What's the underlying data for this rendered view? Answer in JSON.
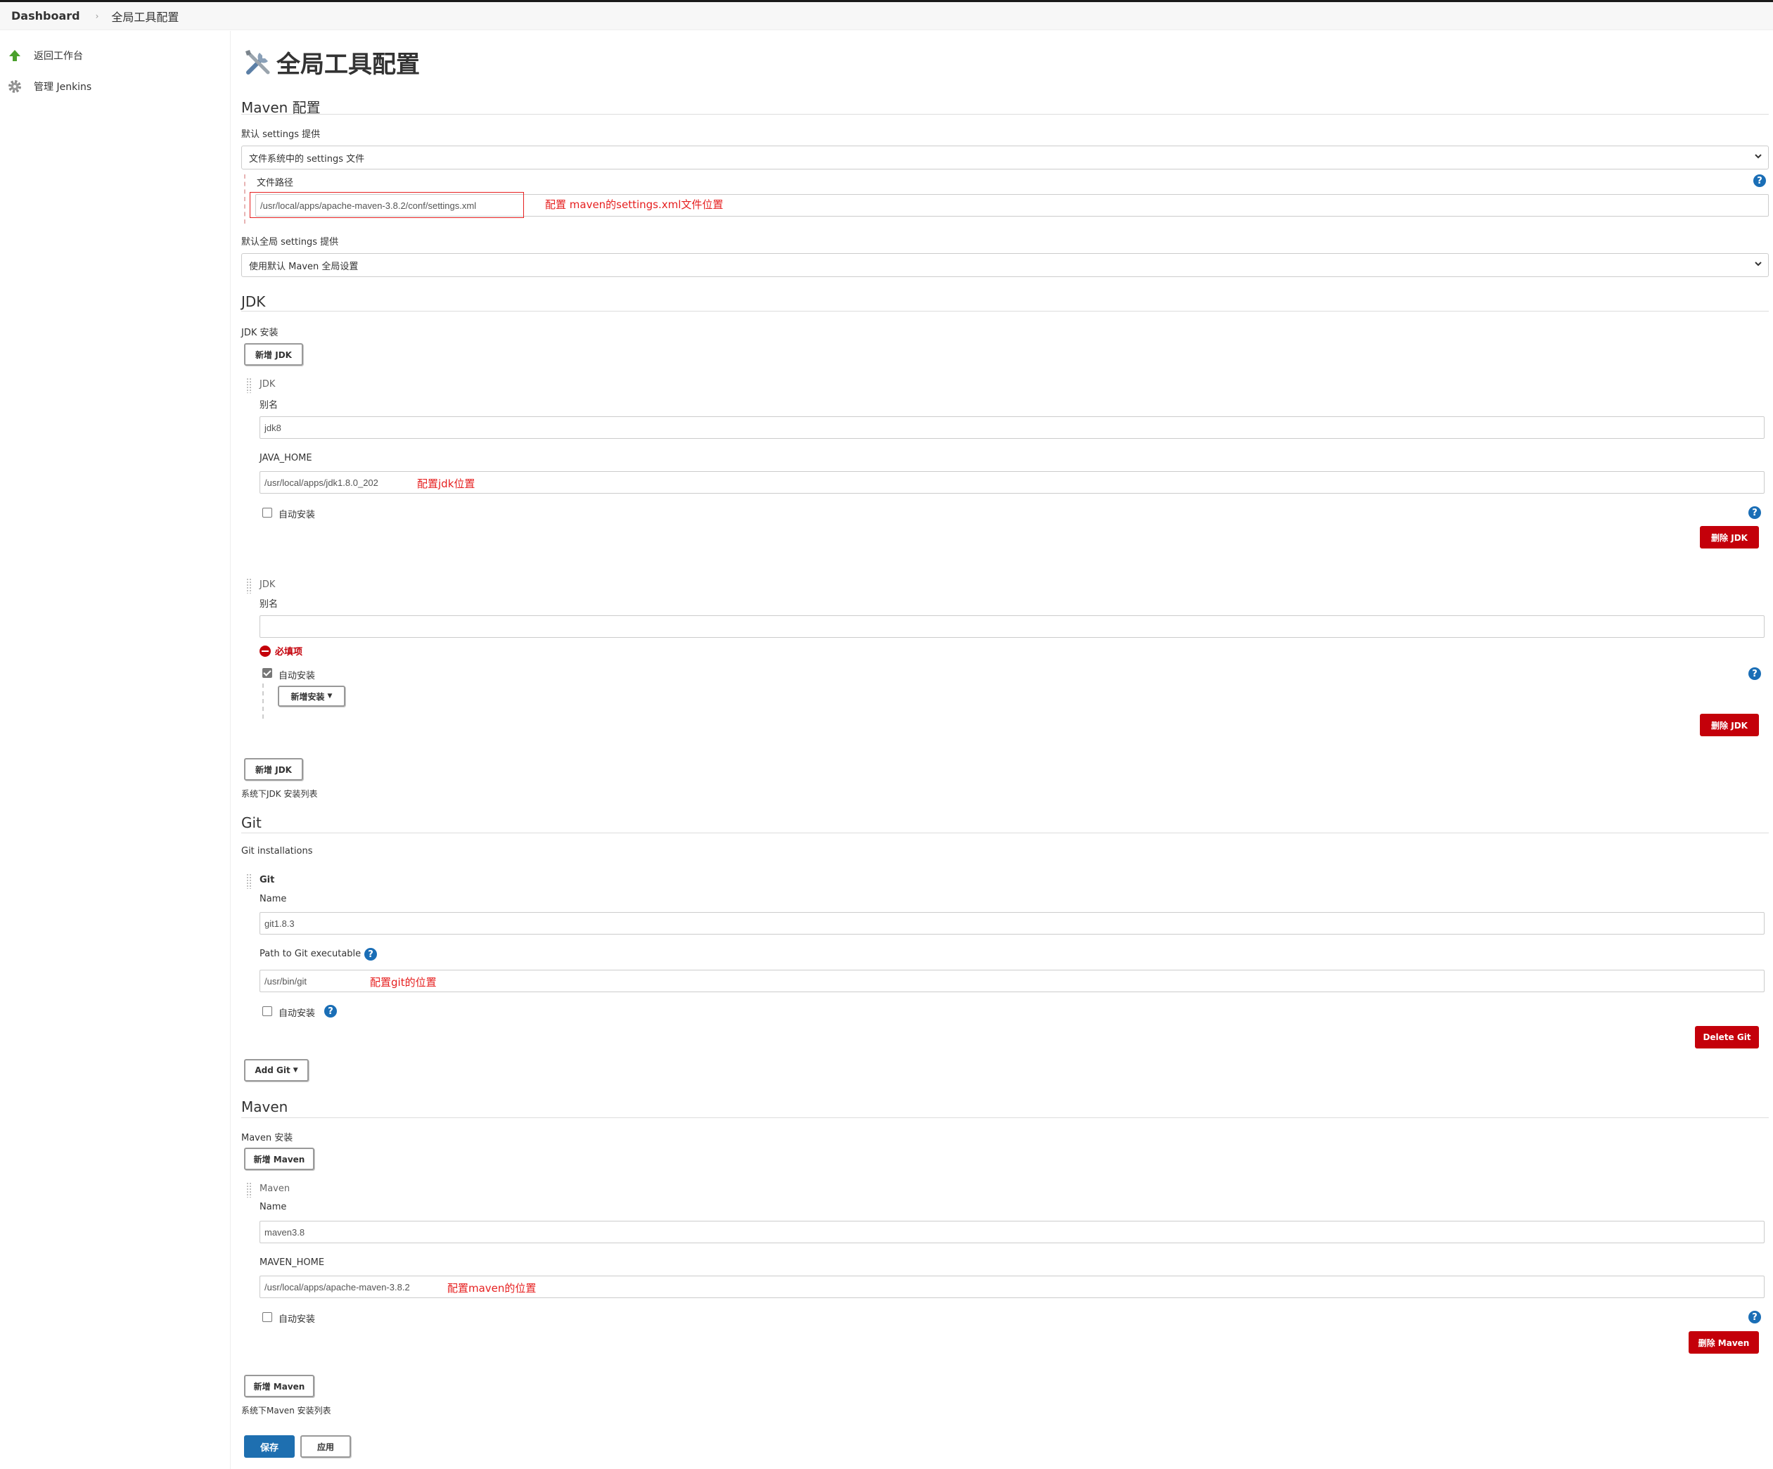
{
  "breadcrumb": {
    "home": "Dashboard",
    "current": "全局工具配置"
  },
  "sidebar": {
    "items": [
      {
        "label": "返回工作台",
        "icon": "up-arrow-icon"
      },
      {
        "label": "管理 Jenkins",
        "icon": "gear-icon"
      }
    ]
  },
  "page": {
    "title": "全局工具配置",
    "icon": "tools-icon"
  },
  "maven_config": {
    "heading": "Maven 配置",
    "settings_label": "默认 settings 提供",
    "settings_value": "文件系统中的 settings 文件",
    "file_path_label": "文件路径",
    "file_path_value": "/usr/local/apps/apache-maven-3.8.2/conf/settings.xml",
    "file_path_annotation": "配置 maven的settings.xml文件位置",
    "global_settings_label": "默认全局 settings 提供",
    "global_settings_value": "使用默认 Maven 全局设置"
  },
  "jdk": {
    "heading": "JDK",
    "install_label": "JDK 安装",
    "add_button": "新增 JDK",
    "entries": [
      {
        "type_label": "JDK",
        "alias_label": "别名",
        "alias_value": "jdk8",
        "java_home_label": "JAVA_HOME",
        "java_home_value": "/usr/local/apps/jdk1.8.0_202",
        "java_home_annotation": "配置jdk位置",
        "auto_install_label": "自动安装",
        "auto_install": false,
        "delete_button": "删除 JDK"
      },
      {
        "type_label": "JDK",
        "alias_label": "别名",
        "alias_value": "",
        "required_message": "必填项",
        "auto_install_label": "自动安装",
        "auto_install": true,
        "add_installer_button": "新增安装",
        "delete_button": "删除 JDK"
      }
    ],
    "list_caption": "系统下JDK 安装列表"
  },
  "git": {
    "heading": "Git",
    "installations_label": "Git installations",
    "entry": {
      "type_label": "Git",
      "name_label": "Name",
      "name_value": "git1.8.3",
      "path_label": "Path to Git executable",
      "path_value": "/usr/bin/git",
      "path_annotation": "配置git的位置",
      "auto_install_label": "自动安装",
      "auto_install": false,
      "delete_button": "Delete Git"
    },
    "add_button": "Add Git"
  },
  "maven": {
    "heading": "Maven",
    "install_label": "Maven 安装",
    "add_button": "新增 Maven",
    "entry": {
      "type_label": "Maven",
      "name_label": "Name",
      "name_value": "maven3.8",
      "home_label": "MAVEN_HOME",
      "home_value": "/usr/local/apps/apache-maven-3.8.2",
      "home_annotation": "配置maven的位置",
      "auto_install_label": "自动安装",
      "auto_install": false,
      "delete_button": "删除 Maven"
    },
    "list_caption": "系统下Maven 安装列表"
  },
  "footer": {
    "save_button": "保存",
    "apply_button": "应用"
  },
  "colors": {
    "danger": "#c4000a",
    "primary": "#1e6fb0",
    "help": "#1a6eb6",
    "annotation": "#e62020"
  }
}
